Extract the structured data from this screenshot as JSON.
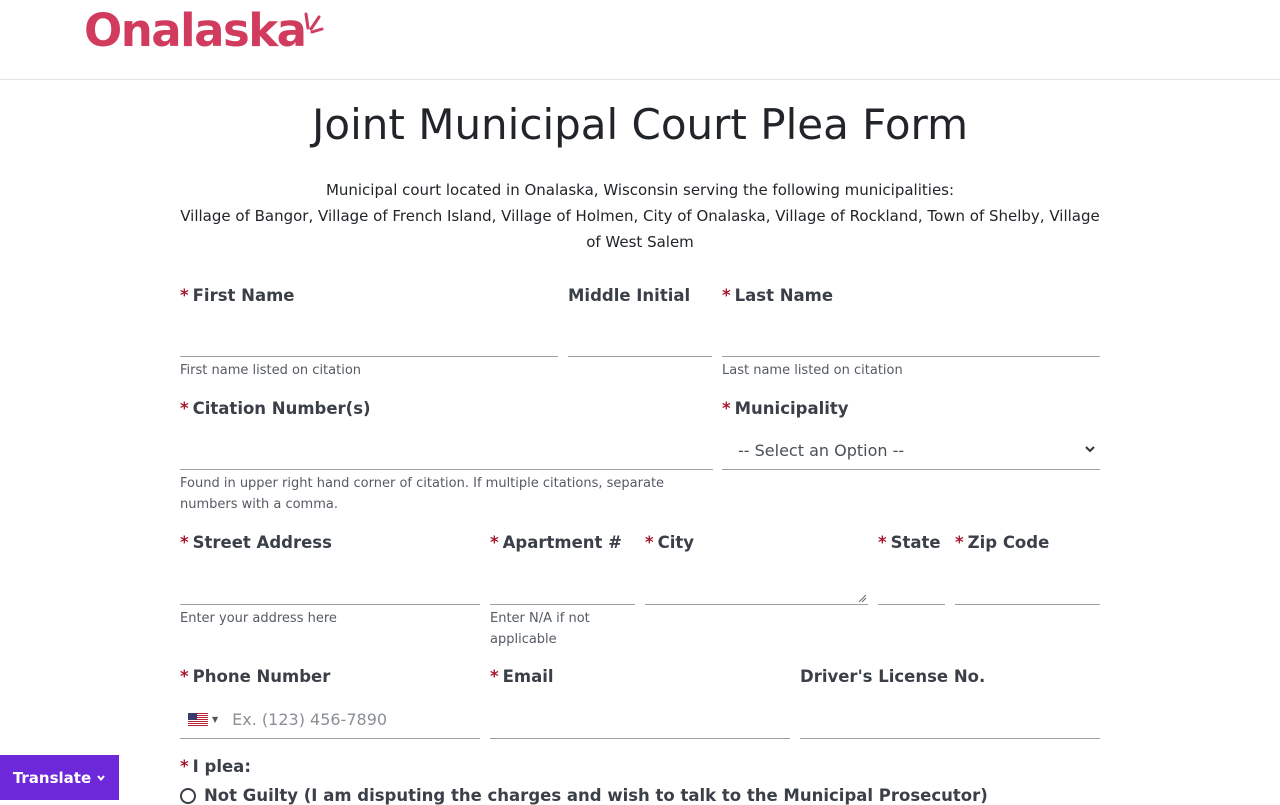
{
  "brand": {
    "logo_text": "Onalaska",
    "logo_color": "#d13b5e"
  },
  "page": {
    "title": "Joint Municipal Court Plea Form",
    "subtitle_line1": "Municipal court located in Onalaska, Wisconsin serving the following municipalities:",
    "subtitle_line2": "Village of Bangor, Village of French Island, Village of Holmen, City of Onalaska, Village of Rockland, Town of Shelby, Village of West Salem"
  },
  "form": {
    "required_marker": "*",
    "first_name": {
      "label": "First Name",
      "value": "",
      "help": "First name listed on citation"
    },
    "middle_initial": {
      "label": "Middle Initial",
      "value": ""
    },
    "last_name": {
      "label": "Last Name",
      "value": "",
      "help": "Last name listed on citation"
    },
    "citation_numbers": {
      "label": "Citation Number(s)",
      "value": "",
      "help": "Found in upper right hand corner of citation. If multiple citations, separate numbers with a comma."
    },
    "municipality": {
      "label": "Municipality",
      "selected": "-- Select an Option --"
    },
    "street_address": {
      "label": "Street Address",
      "value": "",
      "help": "Enter your address here"
    },
    "apartment": {
      "label": "Apartment #",
      "value": "",
      "help": "Enter N/A if not applicable"
    },
    "city": {
      "label": "City",
      "value": ""
    },
    "state": {
      "label": "State",
      "value": ""
    },
    "zip_code": {
      "label": "Zip Code",
      "value": ""
    },
    "phone": {
      "label": "Phone Number",
      "placeholder": "Ex. (123) 456-7890",
      "country_icon": "us-flag-icon"
    },
    "email": {
      "label": "Email",
      "value": ""
    },
    "drivers_license": {
      "label": "Driver's License No.",
      "value": ""
    },
    "plea": {
      "label": "I plea:",
      "options": [
        "Not Guilty (I am disputing the charges and wish to talk to the Municipal Prosecutor)"
      ]
    }
  },
  "translate": {
    "label": "Translate",
    "bg_color": "#6d28d9"
  },
  "colors": {
    "required": "#a6192e",
    "label": "#3a3f48"
  }
}
